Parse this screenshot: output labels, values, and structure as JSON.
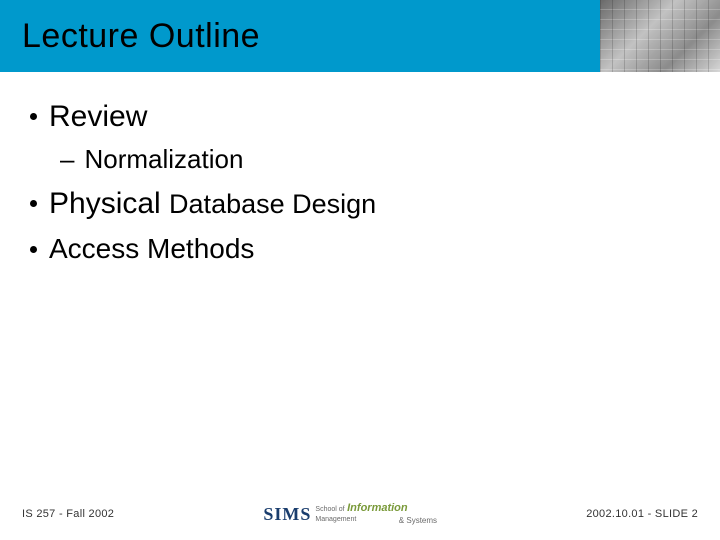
{
  "header": {
    "title": "Lecture Outline"
  },
  "bullets": [
    {
      "text": "Review",
      "sub": [
        {
          "text": "Normalization"
        }
      ]
    },
    {
      "big": "Physical ",
      "med": "Database Design"
    },
    {
      "text": "Access Methods"
    }
  ],
  "footer": {
    "left": "IS 257 - Fall 2002",
    "logo": {
      "mark": "SIMS",
      "line1": "School of",
      "line2": "Information",
      "line3": "Management",
      "line4": "& Systems"
    },
    "right": "2002.10.01 - SLIDE 2"
  }
}
